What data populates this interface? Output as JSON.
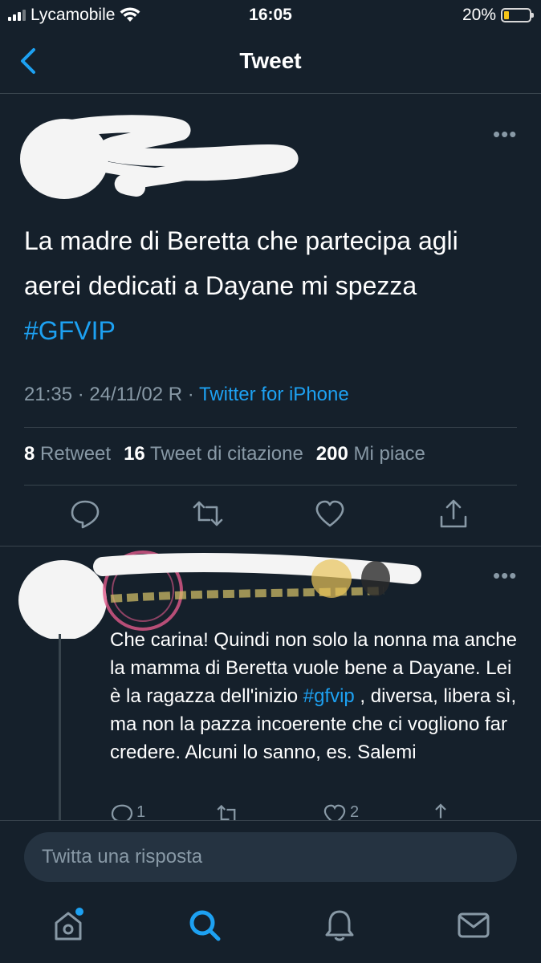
{
  "status_bar": {
    "carrier": "Lycamobile",
    "time": "16:05",
    "battery": "20%",
    "battery_level": 0.2,
    "battery_color": "#f5c518"
  },
  "nav": {
    "title": "Tweet",
    "back_icon": "chevron-left-icon"
  },
  "tweet": {
    "author_redacted": true,
    "text": "La madre di Beretta che partecipa agli aerei dedicati a Dayane mi spezza",
    "hashtag": "#GFVIP",
    "time": "21:35",
    "date": "24/11/02 R",
    "separator": "·",
    "source": "Twitter for iPhone",
    "stats": {
      "retweets": "8",
      "retweets_label": "Retweet",
      "quotes": "16",
      "quotes_label": "Tweet di citazione",
      "likes": "200",
      "likes_label": "Mi piace"
    },
    "actions": [
      "reply-icon",
      "retweet-icon",
      "like-icon",
      "share-icon"
    ]
  },
  "reply": {
    "author_redacted": true,
    "text": "Che carina! Quindi non solo la nonna ma anche la mamma di Beretta vuole bene a Dayane. Lei è la ragazza dell'inizio ",
    "hashtag": "#gfvip",
    "text_after": " , diversa, libera sì, ma non la pazza incoerente che ci vogliono far credere. Alcuni lo sanno, es. Salemi",
    "reply_count": "1",
    "like_count": "2"
  },
  "compose": {
    "placeholder": "Twitta una risposta"
  },
  "tabbar": {
    "tabs": [
      "home-icon",
      "search-icon",
      "notifications-icon",
      "messages-icon"
    ],
    "active": "search-icon",
    "accent": "#1da1f2"
  }
}
